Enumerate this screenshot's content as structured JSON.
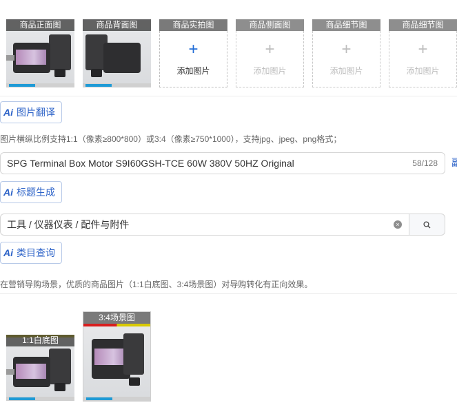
{
  "image_slots": [
    {
      "label": "商品正面图",
      "state": "filled"
    },
    {
      "label": "商品背面图",
      "state": "filled"
    },
    {
      "label": "商品实拍图",
      "state": "empty-active",
      "add_text": "添加图片"
    },
    {
      "label": "商品侧面图",
      "state": "empty",
      "add_text": "添加图片"
    },
    {
      "label": "商品细节图",
      "state": "empty",
      "add_text": "添加图片"
    },
    {
      "label": "商品细节图",
      "state": "empty",
      "add_text": "添加图片"
    }
  ],
  "ai_buttons": {
    "image_translate": "图片翻译",
    "title_generate": "标题生成",
    "category_query": "类目查询",
    "ai_glyph": "Ai"
  },
  "image_hint": "图片横纵比例支持1:1（像素≥800*800）或3:4（像素≥750*1000），支持jpg、jpeg、png格式；",
  "title_field": {
    "value": "SPG Terminal Box Motor S9I60GSH-TCE 60W 380V 50HZ Original",
    "count": "58/128",
    "edge_glyph": "副"
  },
  "category_field": {
    "value": "工具 / 仪器仪表 / 配件与附件",
    "clear_icon": "×",
    "search_icon": "search-icon"
  },
  "guide_hint": "在营销导购场景，优质的商品图片（1:1白底图、3:4场景图）对导购转化有正向效果。",
  "scene_images": {
    "white_bg": "1:1白底图",
    "scene": "3:4场景图"
  },
  "colors": {
    "accent": "#2d63c8",
    "plus_active": "#1f6bd6"
  }
}
